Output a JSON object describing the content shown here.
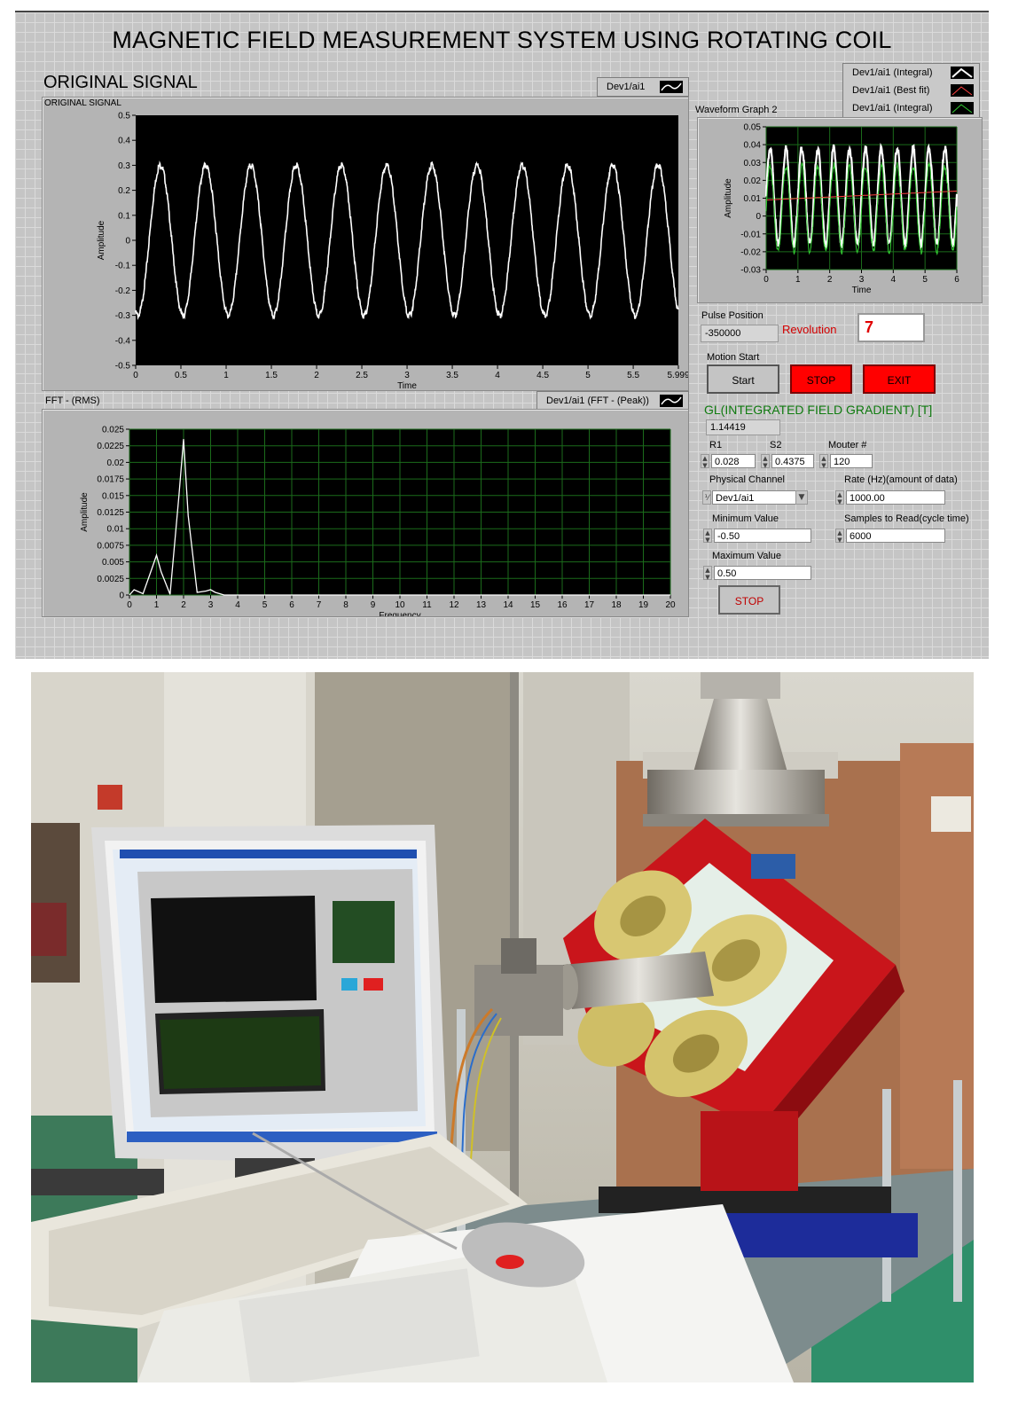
{
  "panel": {
    "title": "MAGNETIC FIELD MEASUREMENT SYSTEM USING ROTATING COIL",
    "original_signal_header": "ORIGINAL SIGNAL",
    "original_signal_graph_label": "ORIGINAL SIGNAL",
    "original_signal_legend": "Dev1/ai1",
    "fft_graph_label": "FFT - (RMS)",
    "fft_legend": "Dev1/ai1 (FFT - (Peak))",
    "waveform2_label": "Waveform Graph 2",
    "waveform2_legend": [
      "Dev1/ai1 (Integral)",
      "Dev1/ai1 (Best fit)",
      "Dev1/ai1 (Integral)"
    ],
    "pulse_position_label": "Pulse Position",
    "pulse_position_value": "-350000",
    "revolution_label": "Revolution",
    "revolution_value": "7",
    "motion_start_label": "Motion Start",
    "start_button": "Start",
    "stop_button": "STOP",
    "exit_button": "EXIT",
    "gl_label": "GL(INTEGRATED FIELD GRADIENT) [T]",
    "gl_value": "1.14419",
    "r1_label": "R1",
    "r1_value": "0.028",
    "s2_label": "S2",
    "s2_value": "0.4375",
    "mouter_label": "Mouter #",
    "mouter_value": "120",
    "physical_channel_label": "Physical Channel",
    "physical_channel_value": "Dev1/ai1",
    "rate_label": "Rate (Hz)(amount of data)",
    "rate_value": "1000.00",
    "min_label": "Minimum Value",
    "min_value": "-0.50",
    "samples_label": "Samples to Read(cycle time)",
    "samples_value": "6000",
    "max_label": "Maximum Value",
    "max_value": "0.50",
    "stop2_button": "STOP"
  },
  "chart_data": [
    {
      "type": "line",
      "title": "ORIGINAL SIGNAL",
      "xlabel": "Time",
      "ylabel": "Amplitude",
      "xlim": [
        0,
        5.999
      ],
      "ylim": [
        -0.5,
        0.5
      ],
      "x_ticks": [
        "0",
        "0.5",
        "1",
        "1.5",
        "2",
        "2.5",
        "3",
        "3.5",
        "4",
        "4.5",
        "5",
        "5.5",
        "5.999"
      ],
      "y_ticks": [
        "0.5",
        "0.4",
        "0.3",
        "0.2",
        "0.1",
        "0",
        "-0.1",
        "-0.2",
        "-0.3",
        "-0.4",
        "-0.5"
      ],
      "series": [
        {
          "name": "Dev1/ai1",
          "color": "#ffffff",
          "amplitude": 0.31,
          "frequency_hz": 2,
          "phase_start_value": -0.3,
          "noise": "small"
        }
      ],
      "grid": false
    },
    {
      "type": "line",
      "title": "FFT - (RMS)",
      "xlabel": "Frequency",
      "ylabel": "Amplitude",
      "xlim": [
        0,
        20
      ],
      "ylim": [
        0,
        0.025
      ],
      "x_ticks": [
        "0",
        "1",
        "2",
        "3",
        "4",
        "5",
        "6",
        "7",
        "8",
        "9",
        "10",
        "11",
        "12",
        "13",
        "14",
        "15",
        "16",
        "17",
        "18",
        "19",
        "20"
      ],
      "y_ticks": [
        "0.025",
        "0.0225",
        "0.02",
        "0.0175",
        "0.015",
        "0.0125",
        "0.01",
        "0.0075",
        "0.005",
        "0.0025",
        "0"
      ],
      "series": [
        {
          "name": "Dev1/ai1 (FFT - (Peak))",
          "color": "#ffffff",
          "x": [
            0,
            0.17,
            0.5,
            0.83,
            1.0,
            1.17,
            1.5,
            1.83,
            2.0,
            2.17,
            2.5,
            2.83,
            3.0,
            3.17,
            3.5,
            4,
            20
          ],
          "y": [
            0.0,
            0.0008,
            0.0002,
            0.004,
            0.006,
            0.0035,
            0.0001,
            0.015,
            0.0235,
            0.012,
            0.0004,
            0.0006,
            0.0008,
            0.0004,
            0.0,
            0.0,
            0.0
          ]
        }
      ],
      "grid": true
    },
    {
      "type": "line",
      "title": "Waveform Graph 2",
      "xlabel": "Time",
      "ylabel": "Amplitude",
      "xlim": [
        0,
        6
      ],
      "ylim": [
        -0.03,
        0.05
      ],
      "x_ticks": [
        "0",
        "1",
        "2",
        "3",
        "4",
        "5",
        "6"
      ],
      "y_ticks": [
        "0.05",
        "0.04",
        "0.03",
        "0.02",
        "0.01",
        "0",
        "-0.01",
        "-0.02",
        "-0.03"
      ],
      "series": [
        {
          "name": "Dev1/ai1 (Integral)",
          "color": "#ffffff",
          "offset": 0.011,
          "amplitude": 0.027,
          "frequency_hz": 2
        },
        {
          "name": "Dev1/ai1 (Best fit)",
          "color": "#ff4040",
          "start": 0.009,
          "end": 0.014
        },
        {
          "name": "Dev1/ai1 (Integral)",
          "color": "#33cc33",
          "offset": 0.004,
          "amplitude": 0.024,
          "frequency_hz": 2
        }
      ],
      "grid": true
    }
  ]
}
